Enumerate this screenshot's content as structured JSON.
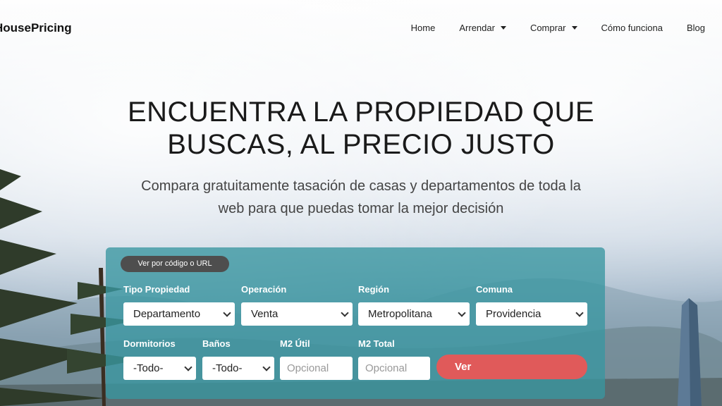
{
  "brand": {
    "logo": "HousePricing"
  },
  "nav": {
    "home": "Home",
    "arrendar": "Arrendar",
    "comprar": "Comprar",
    "como": "Cómo funciona",
    "blog": "Blog"
  },
  "hero": {
    "title_line1": "ENCUENTRA LA PROPIEDAD QUE",
    "title_line2": "BUSCAS, AL PRECIO JUSTO",
    "subtitle_line1": "Compara gratuitamente tasación de casas y departamentos de toda la",
    "subtitle_line2": "web para que puedas tomar la mejor decisión"
  },
  "search": {
    "pill": "Ver por código o URL",
    "tipo_label": "Tipo Propiedad",
    "tipo_value": "Departamento",
    "operacion_label": "Operación",
    "operacion_value": "Venta",
    "region_label": "Región",
    "region_value": "Metropolitana",
    "comuna_label": "Comuna",
    "comuna_value": "Providencia",
    "dormitorios_label": "Dormitorios",
    "dormitorios_value": "-Todo-",
    "banos_label": "Baños",
    "banos_value": "-Todo-",
    "m2util_label": "M2 Útil",
    "m2util_placeholder": "Opcional",
    "m2total_label": "M2 Total",
    "m2total_placeholder": "Opcional",
    "submit": "Ver"
  },
  "colors": {
    "panel": "#3896a0",
    "submit": "#e05a5a",
    "pill": "#4e4e4e"
  }
}
